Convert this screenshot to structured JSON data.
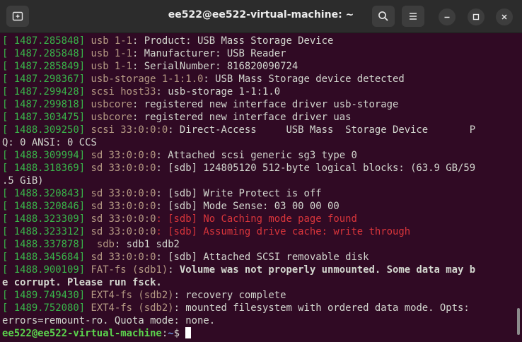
{
  "window": {
    "title": "ee522@ee522-virtual-machine: ~"
  },
  "icons": {
    "new_tab": "new-tab-icon",
    "search": "search-icon",
    "menu": "hamburger-menu-icon",
    "minimize": "minimize-icon",
    "maximize": "maximize-icon",
    "close": "close-icon"
  },
  "colors": {
    "background": "#300a24",
    "timestamp": "#39b54a",
    "device": "#b59a84",
    "error": "#d9353b",
    "prompt_user": "#5bd44d",
    "prompt_path": "#6b8ed8"
  },
  "lines": [
    [
      {
        "t": "[ ",
        "c": "ts"
      },
      {
        "t": "1487.285848",
        "c": "ts"
      },
      {
        "t": "] ",
        "c": "ts"
      },
      {
        "t": "usb 1-1",
        "c": "dev"
      },
      {
        "t": ": Product: USB Mass Storage Device"
      }
    ],
    [
      {
        "t": "[ ",
        "c": "ts"
      },
      {
        "t": "1487.285848",
        "c": "ts"
      },
      {
        "t": "] ",
        "c": "ts"
      },
      {
        "t": "usb 1-1",
        "c": "dev"
      },
      {
        "t": ": Manufacturer: USB Reader"
      }
    ],
    [
      {
        "t": "[ ",
        "c": "ts"
      },
      {
        "t": "1487.285849",
        "c": "ts"
      },
      {
        "t": "] ",
        "c": "ts"
      },
      {
        "t": "usb 1-1",
        "c": "dev"
      },
      {
        "t": ": SerialNumber: 816820090724"
      }
    ],
    [
      {
        "t": "[ ",
        "c": "ts"
      },
      {
        "t": "1487.298367",
        "c": "ts"
      },
      {
        "t": "] ",
        "c": "ts"
      },
      {
        "t": "usb-storage 1-1:1.0",
        "c": "dev"
      },
      {
        "t": ": USB Mass Storage device detected"
      }
    ],
    [
      {
        "t": "[ ",
        "c": "ts"
      },
      {
        "t": "1487.299428",
        "c": "ts"
      },
      {
        "t": "] ",
        "c": "ts"
      },
      {
        "t": "scsi host33",
        "c": "dev"
      },
      {
        "t": ": usb-storage 1-1:1.0"
      }
    ],
    [
      {
        "t": "[ ",
        "c": "ts"
      },
      {
        "t": "1487.299818",
        "c": "ts"
      },
      {
        "t": "] ",
        "c": "ts"
      },
      {
        "t": "usbcore",
        "c": "dev"
      },
      {
        "t": ": registered new interface driver usb-storage"
      }
    ],
    [
      {
        "t": "[ ",
        "c": "ts"
      },
      {
        "t": "1487.303475",
        "c": "ts"
      },
      {
        "t": "] ",
        "c": "ts"
      },
      {
        "t": "usbcore",
        "c": "dev"
      },
      {
        "t": ": registered new interface driver uas"
      }
    ],
    [
      {
        "t": "[ ",
        "c": "ts"
      },
      {
        "t": "1488.309250",
        "c": "ts"
      },
      {
        "t": "] ",
        "c": "ts"
      },
      {
        "t": "scsi 33:0:0:0",
        "c": "dev"
      },
      {
        "t": ": Direct-Access     USB Mass  Storage Device       P"
      }
    ],
    [
      {
        "t": "Q: 0 ANSI: 0 CCS"
      }
    ],
    [
      {
        "t": "[ ",
        "c": "ts"
      },
      {
        "t": "1488.309994",
        "c": "ts"
      },
      {
        "t": "] ",
        "c": "ts"
      },
      {
        "t": "sd 33:0:0:0",
        "c": "dev"
      },
      {
        "t": ": Attached scsi generic sg3 type 0"
      }
    ],
    [
      {
        "t": "[ ",
        "c": "ts"
      },
      {
        "t": "1488.318369",
        "c": "ts"
      },
      {
        "t": "] ",
        "c": "ts"
      },
      {
        "t": "sd 33:0:0:0",
        "c": "dev"
      },
      {
        "t": ": [sdb] 124805120 512-byte logical blocks: (63.9 GB/59"
      }
    ],
    [
      {
        "t": ".5 GiB)"
      }
    ],
    [
      {
        "t": "[ ",
        "c": "ts"
      },
      {
        "t": "1488.320843",
        "c": "ts"
      },
      {
        "t": "] ",
        "c": "ts"
      },
      {
        "t": "sd 33:0:0:0",
        "c": "dev"
      },
      {
        "t": ": [sdb] Write Protect is off"
      }
    ],
    [
      {
        "t": "[ ",
        "c": "ts"
      },
      {
        "t": "1488.320846",
        "c": "ts"
      },
      {
        "t": "] ",
        "c": "ts"
      },
      {
        "t": "sd 33:0:0:0",
        "c": "dev"
      },
      {
        "t": ": [sdb] Mode Sense: 03 00 00 00"
      }
    ],
    [
      {
        "t": "[ ",
        "c": "ts"
      },
      {
        "t": "1488.323309",
        "c": "ts"
      },
      {
        "t": "] ",
        "c": "ts"
      },
      {
        "t": "sd 33:0:0:0",
        "c": "dev"
      },
      {
        "t": ": [sdb] No Caching mode page found",
        "c": "err"
      }
    ],
    [
      {
        "t": "[ ",
        "c": "ts"
      },
      {
        "t": "1488.323312",
        "c": "ts"
      },
      {
        "t": "] ",
        "c": "ts"
      },
      {
        "t": "sd 33:0:0:0",
        "c": "dev"
      },
      {
        "t": ": [sdb] Assuming drive cache: write through",
        "c": "err"
      }
    ],
    [
      {
        "t": "[ ",
        "c": "ts"
      },
      {
        "t": "1488.337878",
        "c": "ts"
      },
      {
        "t": "] ",
        "c": "ts"
      },
      {
        "t": " sdb",
        "c": "dev"
      },
      {
        "t": ": sdb1 sdb2"
      }
    ],
    [
      {
        "t": "[ ",
        "c": "ts"
      },
      {
        "t": "1488.345684",
        "c": "ts"
      },
      {
        "t": "] ",
        "c": "ts"
      },
      {
        "t": "sd 33:0:0:0",
        "c": "dev"
      },
      {
        "t": ": [sdb] Attached SCSI removable disk"
      }
    ],
    [
      {
        "t": "[ ",
        "c": "ts"
      },
      {
        "t": "1488.900109",
        "c": "ts"
      },
      {
        "t": "] ",
        "c": "ts"
      },
      {
        "t": "FAT-fs (sdb1)",
        "c": "dev"
      },
      {
        "t": ": "
      },
      {
        "t": "Volume was not properly unmounted. Some data may b",
        "c": "b"
      }
    ],
    [
      {
        "t": "e corrupt. Please run fsck.",
        "c": "b"
      }
    ],
    [
      {
        "t": "[ ",
        "c": "ts"
      },
      {
        "t": "1489.749430",
        "c": "ts"
      },
      {
        "t": "] ",
        "c": "ts"
      },
      {
        "t": "EXT4-fs (sdb2)",
        "c": "dev"
      },
      {
        "t": ": recovery complete"
      }
    ],
    [
      {
        "t": "[ ",
        "c": "ts"
      },
      {
        "t": "1489.752080",
        "c": "ts"
      },
      {
        "t": "] ",
        "c": "ts"
      },
      {
        "t": "EXT4-fs (sdb2)",
        "c": "dev"
      },
      {
        "t": ": mounted filesystem with ordered data mode. Opts:"
      }
    ],
    [
      {
        "t": "errors=remount-ro. Quota mode: none."
      }
    ]
  ],
  "prompt": {
    "user_host": "ee522@ee522-virtual-machine",
    "separator": ":",
    "path": "~",
    "symbol": "$ "
  }
}
